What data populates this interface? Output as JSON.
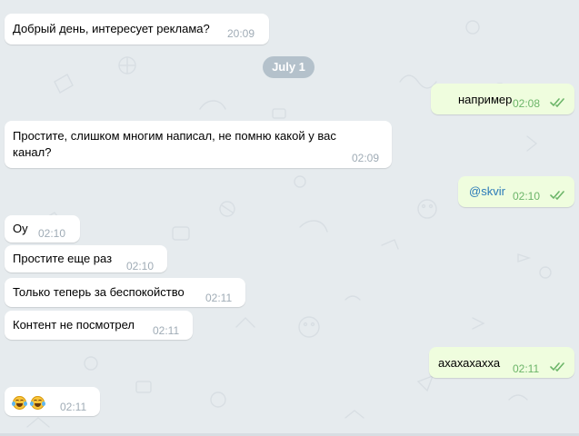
{
  "conversation": {
    "date_separator": "July 1",
    "messages": [
      {
        "text": "Добрый день, интересует реклама?",
        "time": "20:09",
        "direction": "incoming"
      },
      {
        "text": "например",
        "time": "02:08",
        "direction": "outgoing"
      },
      {
        "text_line1": "Простите, слишком многим написал, не помню какой у вас",
        "text_line2": "канал?",
        "time": "02:09",
        "direction": "incoming"
      },
      {
        "text": "@skvir",
        "time": "02:10",
        "direction": "outgoing"
      },
      {
        "text": "Оу",
        "time": "02:10",
        "direction": "incoming"
      },
      {
        "text": "Простите еще раз",
        "time": "02:10",
        "direction": "incoming"
      },
      {
        "text": "Только теперь за беспокойство",
        "time": "02:11",
        "direction": "incoming"
      },
      {
        "text": "Контент не посмотрел",
        "time": "02:11",
        "direction": "incoming"
      },
      {
        "text": "ахахахахха",
        "time": "02:11",
        "direction": "outgoing"
      },
      {
        "emoji": "face-with-tears-of-joy x2",
        "time": "02:11",
        "direction": "incoming"
      }
    ]
  },
  "colors": {
    "background": "#e6ebee",
    "incoming_bubble": "#ffffff",
    "outgoing_bubble": "#effdde",
    "outgoing_time": "#6cb569",
    "link": "#2a7ab8"
  }
}
